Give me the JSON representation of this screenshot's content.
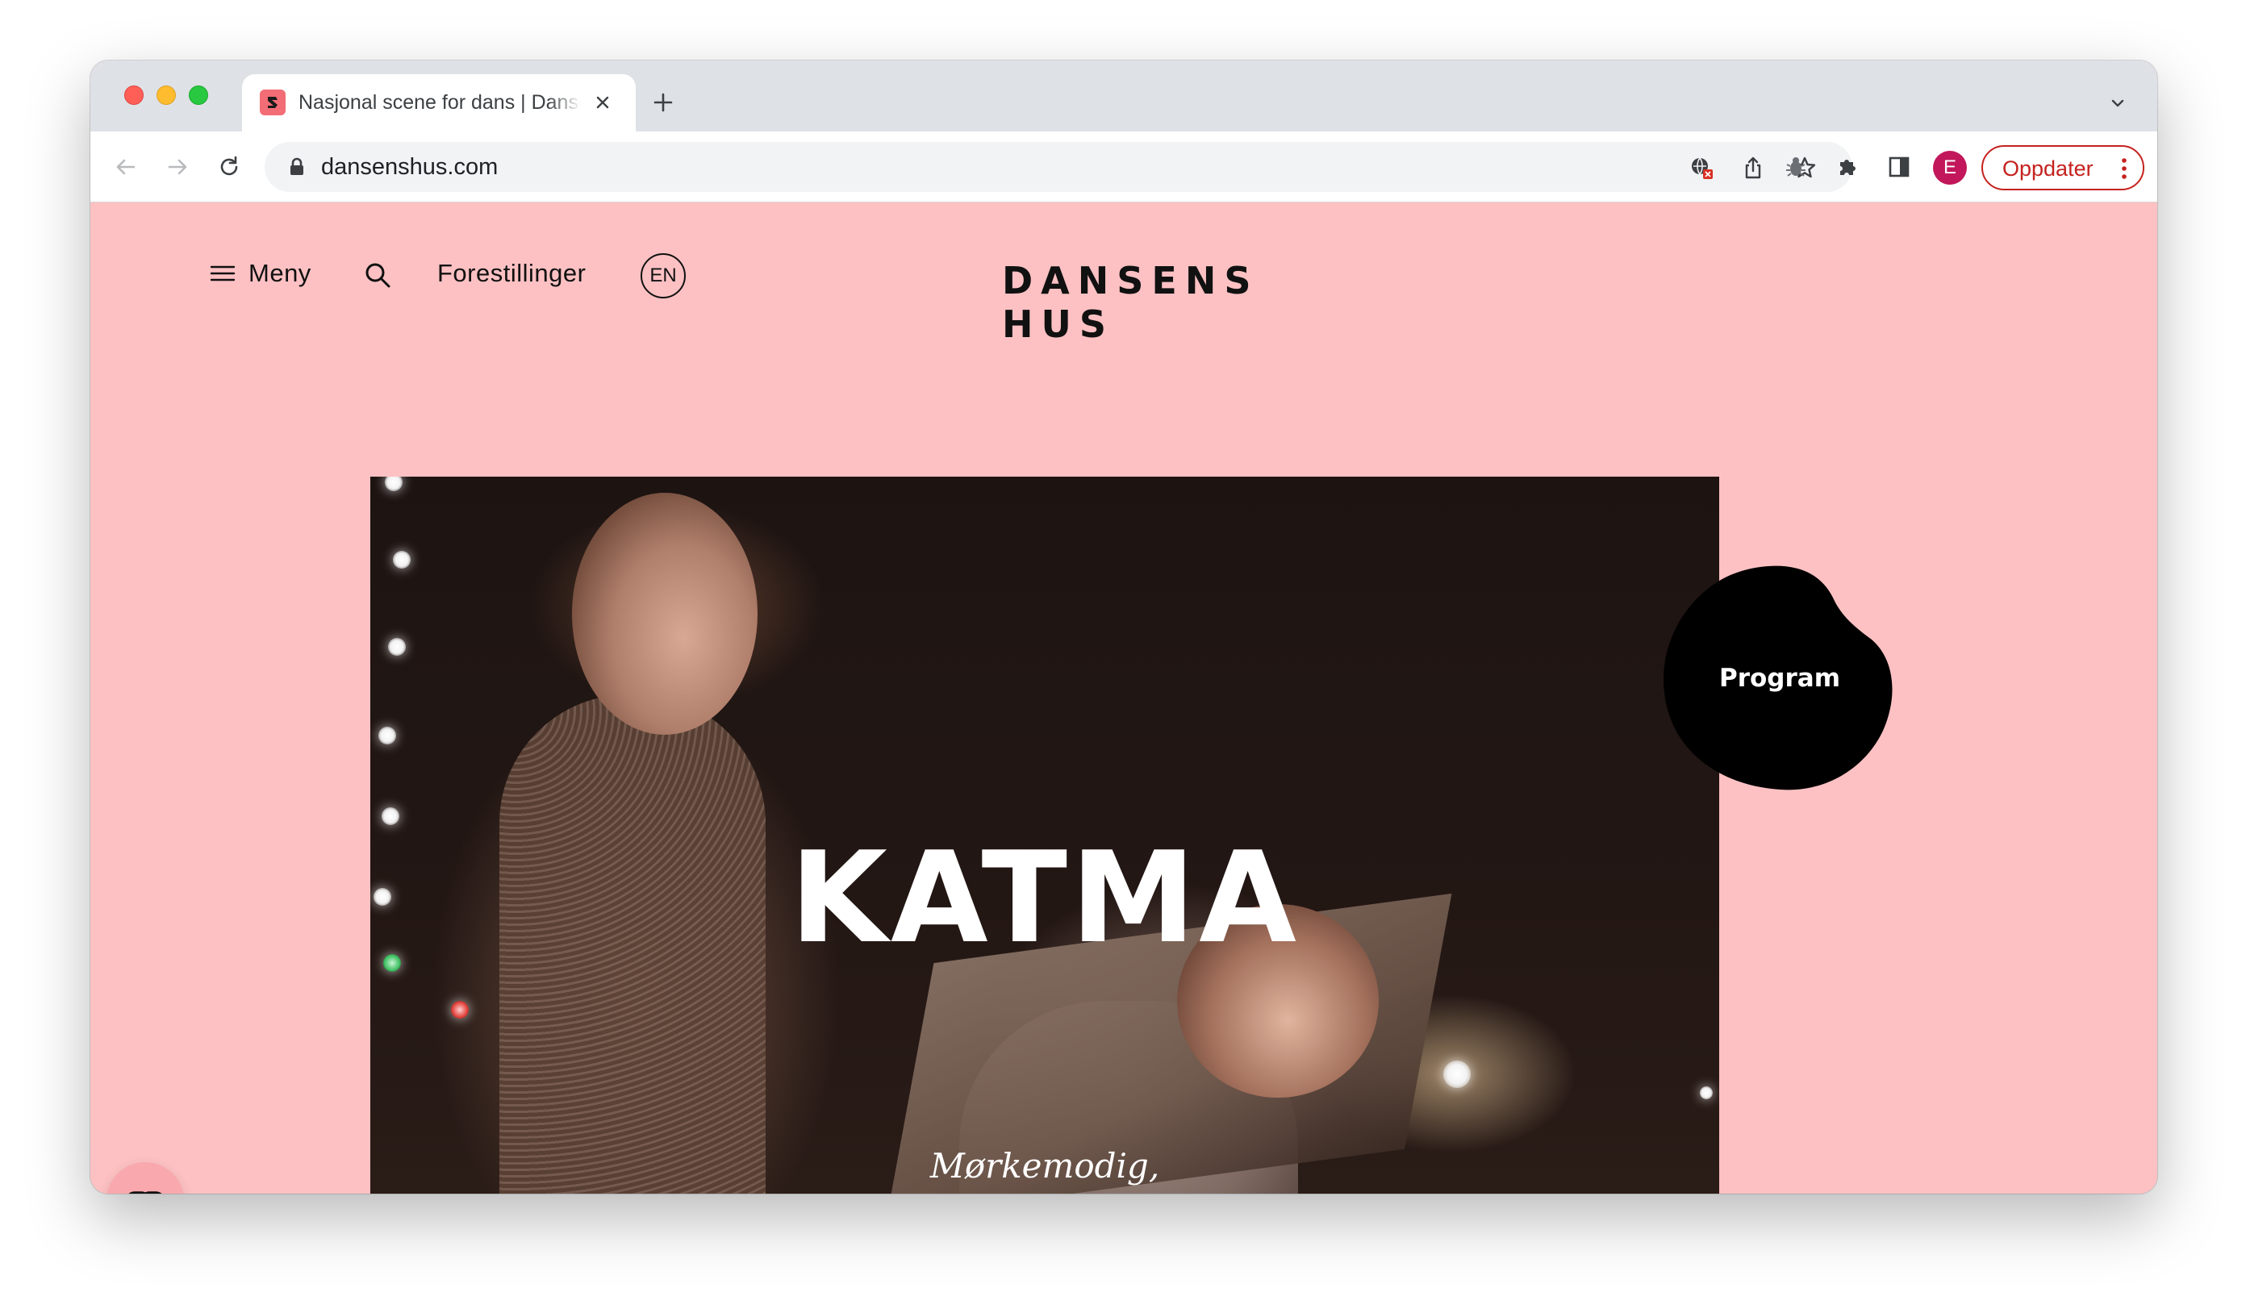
{
  "browser": {
    "tab_title": "Nasjonal scene for dans | Dansens Hus",
    "url": "dansenshus.com",
    "update_label": "Oppdater",
    "profile_initial": "E"
  },
  "site": {
    "menu_label": "Meny",
    "performances_label": "Forestillinger",
    "language_label": "EN",
    "logo_line1": "DANSENS",
    "logo_line2": "HUS"
  },
  "hero": {
    "title": "KATMA",
    "caption": "Mørkemodig,"
  },
  "program_button": {
    "label": "Program"
  },
  "colors": {
    "page_background": "#fdc1c3",
    "text_dark": "#111111",
    "update_red": "#c5221f",
    "avatar": "#c2185b"
  }
}
